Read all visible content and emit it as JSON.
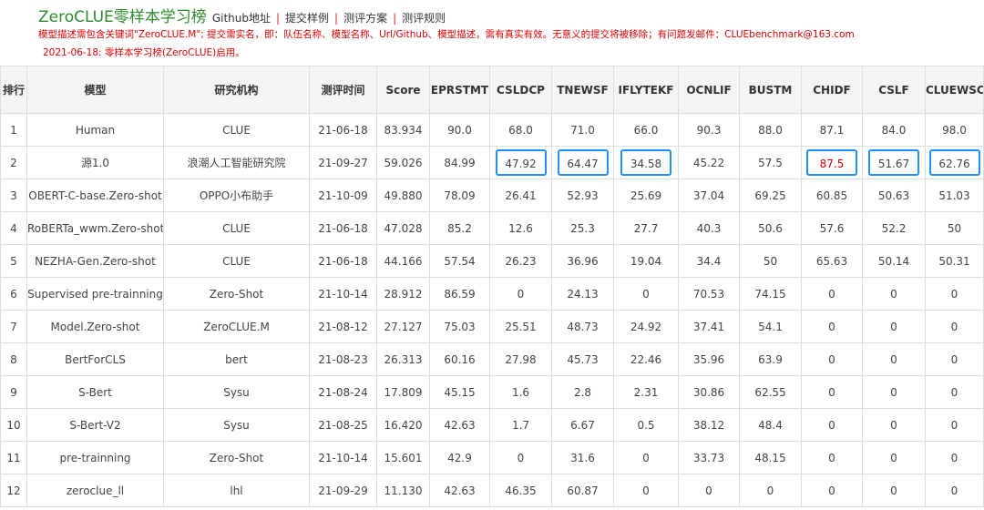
{
  "header": {
    "title": "ZeroCLUE零样本学习榜",
    "nav": [
      {
        "label": "Github地址"
      },
      {
        "label": "提交样例"
      },
      {
        "label": "测评方案"
      },
      {
        "label": "测评规则"
      }
    ],
    "separator": "|",
    "notice_line1": "模型描述需包含关键词\"ZeroCLUE.M\"; 提交需实名，即：队伍名称、模型名称、Url/Github、模型描述，需有真实有效。无意义的提交将被移除；有问题发邮件：CLUEbenchmark@163.com",
    "notice_line2": "2021-06-18: 零样本学习榜(ZeroCLUE)启用。"
  },
  "table": {
    "columns": [
      "排行",
      "模型",
      "研究机构",
      "测评时间",
      "Score",
      "EPRSTMT",
      "CSLDCP",
      "TNEWSF",
      "IFLYTEKF",
      "OCNLIF",
      "BUSTM",
      "CHIDF",
      "CSLF",
      "CLUEWSCF"
    ],
    "rows": [
      {
        "cells": [
          "1",
          "Human",
          "CLUE",
          "21-06-18",
          "83.934",
          "90.0",
          "68.0",
          "71.0",
          "66.0",
          "90.3",
          "88.0",
          "87.1",
          "84.0",
          "98.0"
        ]
      },
      {
        "cells": [
          "2",
          "源1.0",
          "浪潮人工智能研究院",
          "21-09-27",
          "59.026",
          "84.99",
          "47.92",
          "64.47",
          "34.58",
          "45.22",
          "57.5",
          "87.5",
          "51.67",
          "62.76"
        ]
      },
      {
        "cells": [
          "3",
          "OBERT-C-base.Zero-shot",
          "OPPO小布助手",
          "21-10-09",
          "49.880",
          "78.09",
          "26.41",
          "52.93",
          "25.69",
          "37.04",
          "69.25",
          "60.85",
          "50.63",
          "51.03"
        ]
      },
      {
        "cells": [
          "4",
          "RoBERTa_wwm.Zero-shot",
          "CLUE",
          "21-06-18",
          "47.028",
          "85.2",
          "12.6",
          "25.3",
          "27.7",
          "40.3",
          "50.6",
          "57.6",
          "52.2",
          "50"
        ]
      },
      {
        "cells": [
          "5",
          "NEZHA-Gen.Zero-shot",
          "CLUE",
          "21-06-18",
          "44.166",
          "57.54",
          "26.23",
          "36.96",
          "19.04",
          "34.4",
          "50",
          "65.63",
          "50.14",
          "50.31"
        ]
      },
      {
        "cells": [
          "6",
          "Supervised pre-trainning",
          "Zero-Shot",
          "21-10-14",
          "28.912",
          "86.59",
          "0",
          "24.13",
          "0",
          "70.53",
          "74.15",
          "0",
          "0",
          "0"
        ]
      },
      {
        "cells": [
          "7",
          "Model.Zero-shot",
          "ZeroCLUE.M",
          "21-08-12",
          "27.127",
          "75.03",
          "25.51",
          "48.73",
          "24.92",
          "37.41",
          "54.1",
          "0",
          "0",
          "0"
        ]
      },
      {
        "cells": [
          "8",
          "BertForCLS",
          "bert",
          "21-08-23",
          "26.313",
          "60.16",
          "27.98",
          "45.73",
          "22.46",
          "35.96",
          "63.9",
          "0",
          "0",
          "0"
        ]
      },
      {
        "cells": [
          "9",
          "S-Bert",
          "Sysu",
          "21-08-24",
          "17.809",
          "45.15",
          "1.6",
          "2.8",
          "2.31",
          "30.86",
          "62.55",
          "0",
          "0",
          "0"
        ]
      },
      {
        "cells": [
          "10",
          "S-Bert-V2",
          "Sysu",
          "21-08-25",
          "16.420",
          "42.63",
          "1.7",
          "6.67",
          "0.5",
          "38.12",
          "48.4",
          "0",
          "0",
          "0"
        ]
      },
      {
        "cells": [
          "11",
          "pre-trainning",
          "Zero-Shot",
          "21-10-14",
          "15.601",
          "42.9",
          "0",
          "31.6",
          "0",
          "33.73",
          "48.15",
          "0",
          "0",
          "0"
        ]
      },
      {
        "cells": [
          "12",
          "zeroclue_ll",
          "lhl",
          "21-09-29",
          "11.130",
          "42.63",
          "46.35",
          "60.87",
          "0",
          "0",
          "0",
          "0",
          "0",
          "0"
        ]
      }
    ]
  },
  "colors": {
    "title_green": "#2e8b2e",
    "notice_red": "#e00000",
    "model_link": "#5a63b8",
    "highlight_box": "#1e90ff"
  }
}
